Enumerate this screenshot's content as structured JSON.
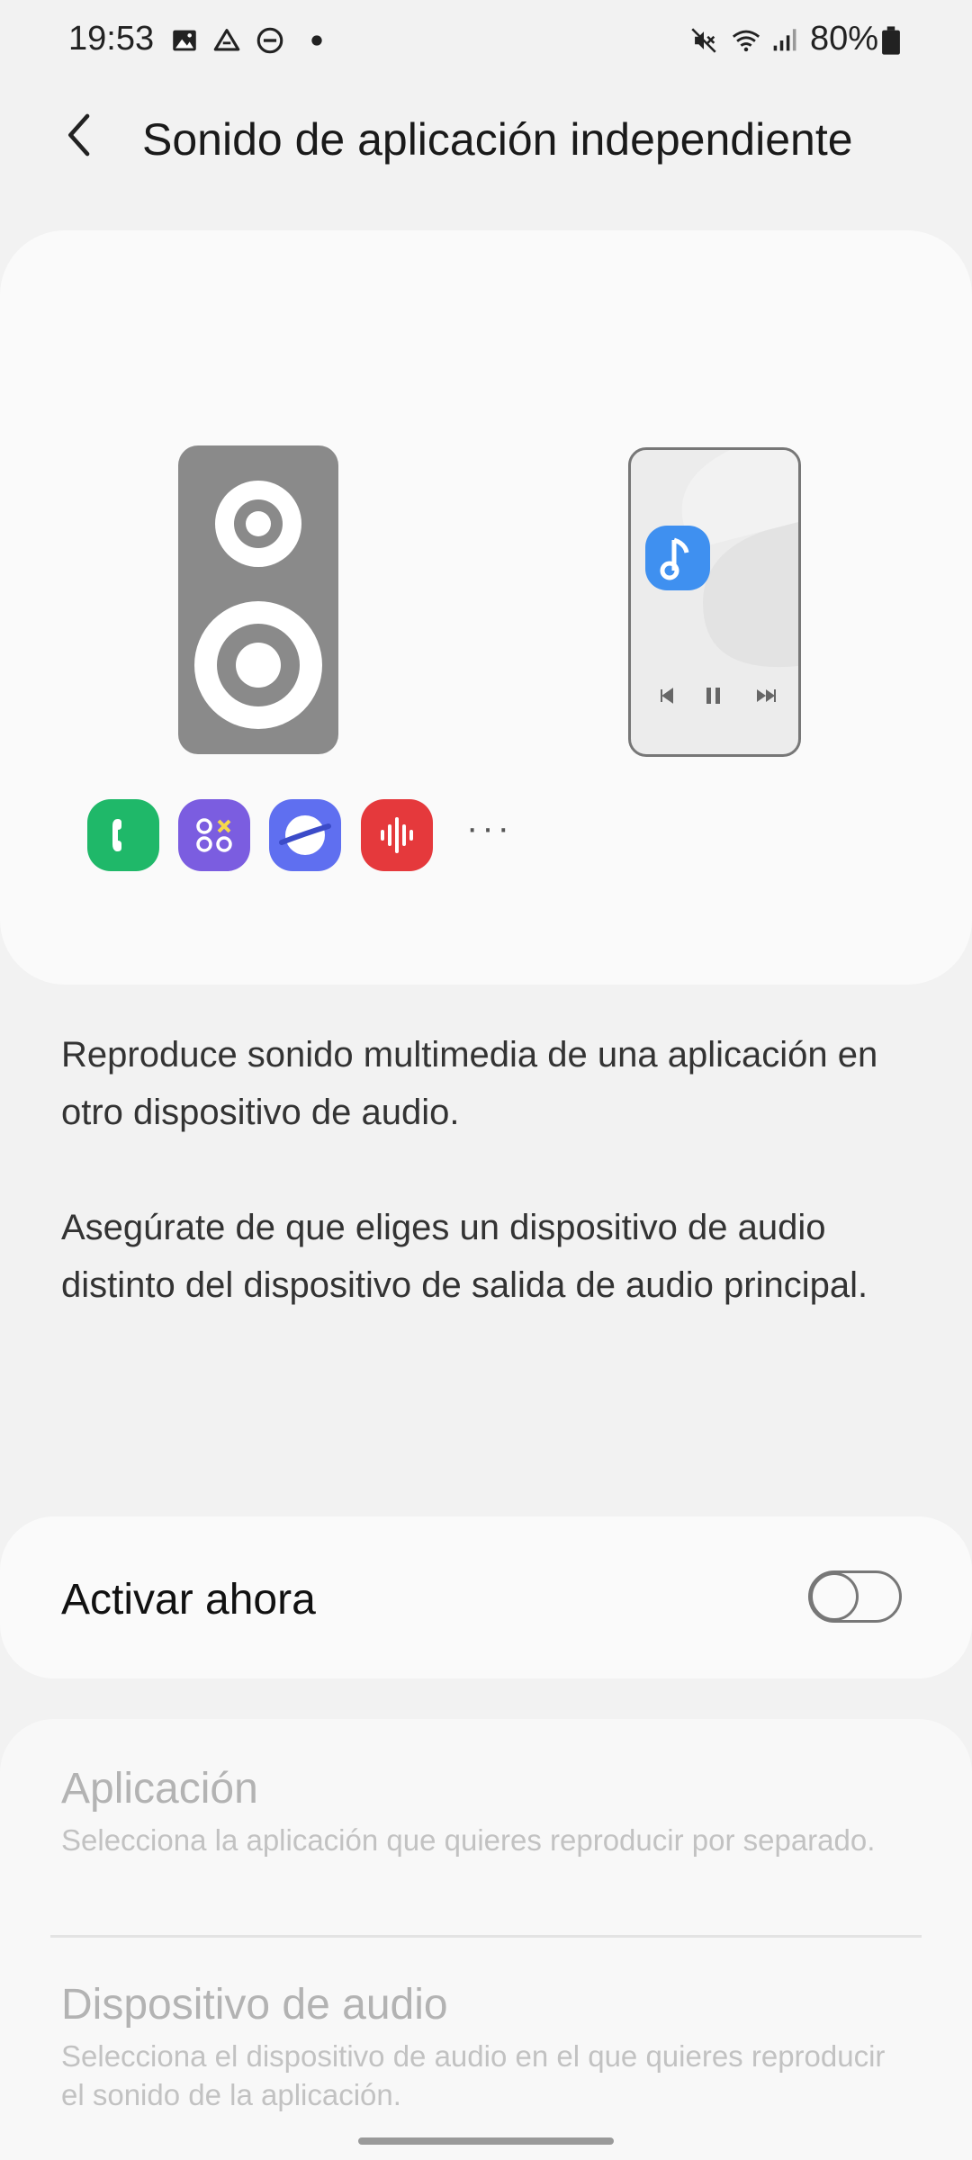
{
  "status_bar": {
    "time": "19:53",
    "battery": "80%",
    "icons": [
      "gallery-icon",
      "drive-icon",
      "dnd-icon",
      "dot-icon",
      "mute-icon",
      "wifi-icon",
      "signal-icon",
      "battery-icon"
    ]
  },
  "header": {
    "back_icon": "chevron-left-icon",
    "title": "Sonido de aplicación independiente"
  },
  "illustration": {
    "app_icons": [
      "phone-app-icon",
      "apps-icon",
      "internet-icon",
      "voice-recorder-icon"
    ],
    "more": "···",
    "colors": {
      "phone_app": "#1fb869",
      "apps": "#7b5de0",
      "internet": "#5f6ff0",
      "recorder": "#e5393c",
      "music": "#3f90f0"
    }
  },
  "description": {
    "line1": "Reproduce sonido multimedia de una aplicación en otro dispositivo de audio.",
    "line2": "Asegúrate de que eliges un dispositivo de audio distinto del dispositivo de salida de audio principal."
  },
  "toggle": {
    "label": "Activar ahora",
    "state": "off"
  },
  "settings": {
    "items": [
      {
        "title": "Aplicación",
        "subtitle": "Selecciona la aplicación que quieres reproducir por separado."
      },
      {
        "title": "Dispositivo de audio",
        "subtitle": "Selecciona el dispositivo de audio en el que quieres reproducir el sonido de la aplicación."
      }
    ]
  }
}
